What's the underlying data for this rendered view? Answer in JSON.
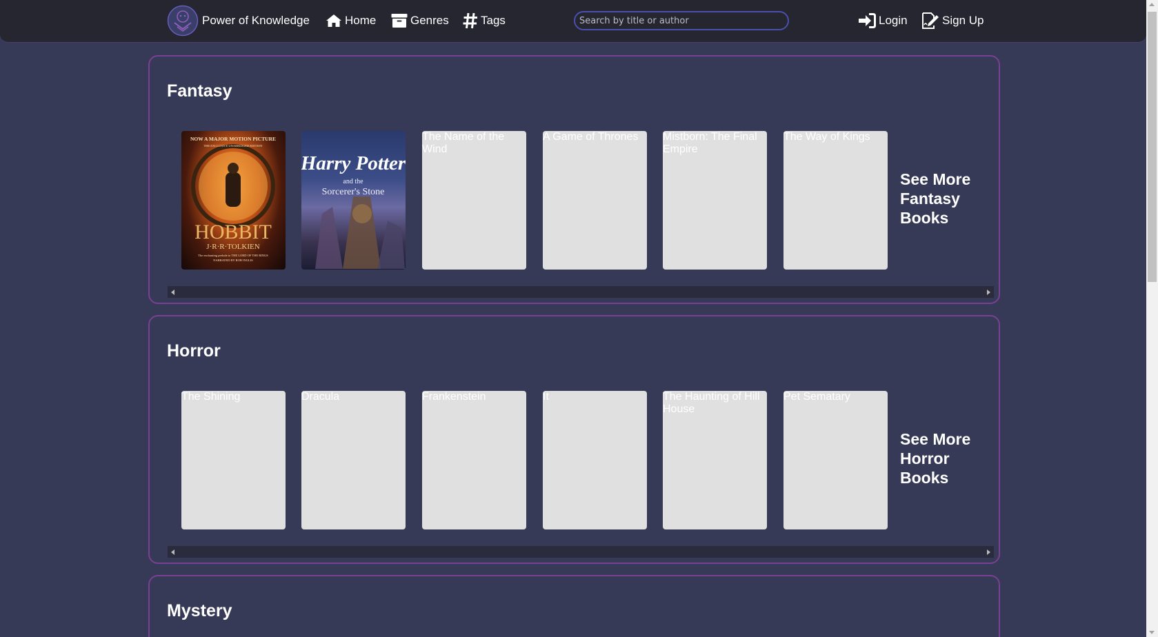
{
  "brand": {
    "name": "Power of Knowledge"
  },
  "nav": {
    "home": "Home",
    "genres": "Genres",
    "tags": "Tags",
    "login": "Login",
    "signup": "Sign Up"
  },
  "search": {
    "placeholder": "Search by title or author",
    "value": ""
  },
  "colors": {
    "accent_border": "#7b3f93",
    "background": "#363a56",
    "navbar": "#25262f",
    "placeholder_cover": "#e0e0e0"
  },
  "sections": [
    {
      "title": "Fantasy",
      "see_more": "See More Fantasy Books",
      "books": [
        {
          "title": "The Hobbit",
          "cover": "hobbit",
          "cover_text": {
            "top": "NOW A MAJOR MOTION PICTURE",
            "edition": "THE EXCLUSIVE UNABRIDGED EDITION",
            "name": "HOBBIT",
            "author": "J·R·R·TOLKIEN",
            "tagline": "The enchanting prelude to THE LORD OF THE RINGS",
            "narrator": "NARRATED BY ROB INGLIS"
          }
        },
        {
          "title": "Harry Potter and the Sorcerer's Stone",
          "cover": "harry-potter",
          "cover_text": {
            "name": "Harry Potter",
            "sub": "and the",
            "subtitle": "Sorcerer's Stone"
          }
        },
        {
          "title": "The Name of the Wind",
          "cover": ""
        },
        {
          "title": "A Game of Thrones",
          "cover": ""
        },
        {
          "title": "Mistborn: The Final Empire",
          "cover": ""
        },
        {
          "title": "The Way of Kings",
          "cover": ""
        }
      ]
    },
    {
      "title": "Horror",
      "see_more": "See More Horror Books",
      "books": [
        {
          "title": "The Shining",
          "cover": ""
        },
        {
          "title": "Dracula",
          "cover": ""
        },
        {
          "title": "Frankenstein",
          "cover": ""
        },
        {
          "title": "It",
          "cover": ""
        },
        {
          "title": "The Haunting of Hill House",
          "cover": ""
        },
        {
          "title": "Pet Sematary",
          "cover": ""
        }
      ]
    },
    {
      "title": "Mystery"
    }
  ]
}
